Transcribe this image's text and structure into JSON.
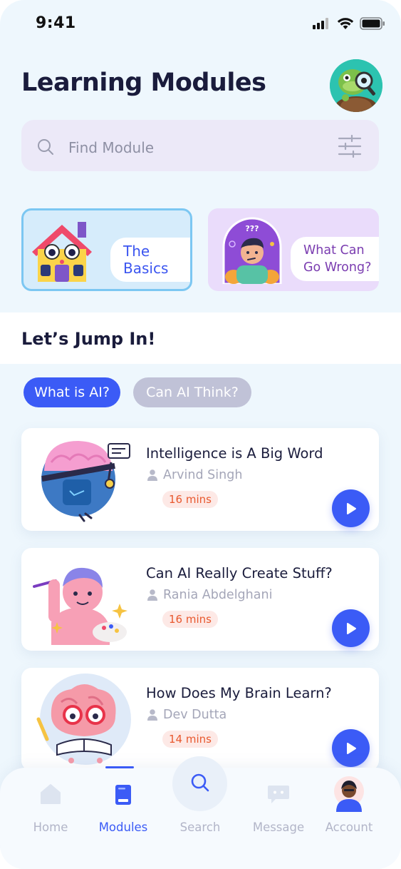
{
  "status_bar": {
    "time": "9:41"
  },
  "header": {
    "title": "Learning Modules"
  },
  "search": {
    "placeholder": "Find Module"
  },
  "categories": [
    {
      "label": "The\nBasics"
    },
    {
      "label": "What Can\nGo Wrong?"
    }
  ],
  "section": {
    "title": "Let’s Jump In!"
  },
  "chips": [
    {
      "label": "What is AI?",
      "active": true
    },
    {
      "label": "Can AI Think?",
      "active": false
    }
  ],
  "modules": [
    {
      "title": "Intelligence is A Big Word",
      "author": "Arvind Singh",
      "duration": "16 mins"
    },
    {
      "title": "Can AI Really Create Stuff?",
      "author": "Rania Abdelghani",
      "duration": "16 mins"
    },
    {
      "title": "How Does My Brain Learn?",
      "author": "Dev Dutta",
      "duration": "14 mins"
    }
  ],
  "nav": {
    "home": "Home",
    "modules": "Modules",
    "search": "Search",
    "message": "Message",
    "account": "Account",
    "active": "modules"
  },
  "colors": {
    "accent": "#3b5bf6",
    "background": "#eef7fd",
    "badge_text": "#e8592f",
    "badge_bg": "#fde9e6"
  }
}
